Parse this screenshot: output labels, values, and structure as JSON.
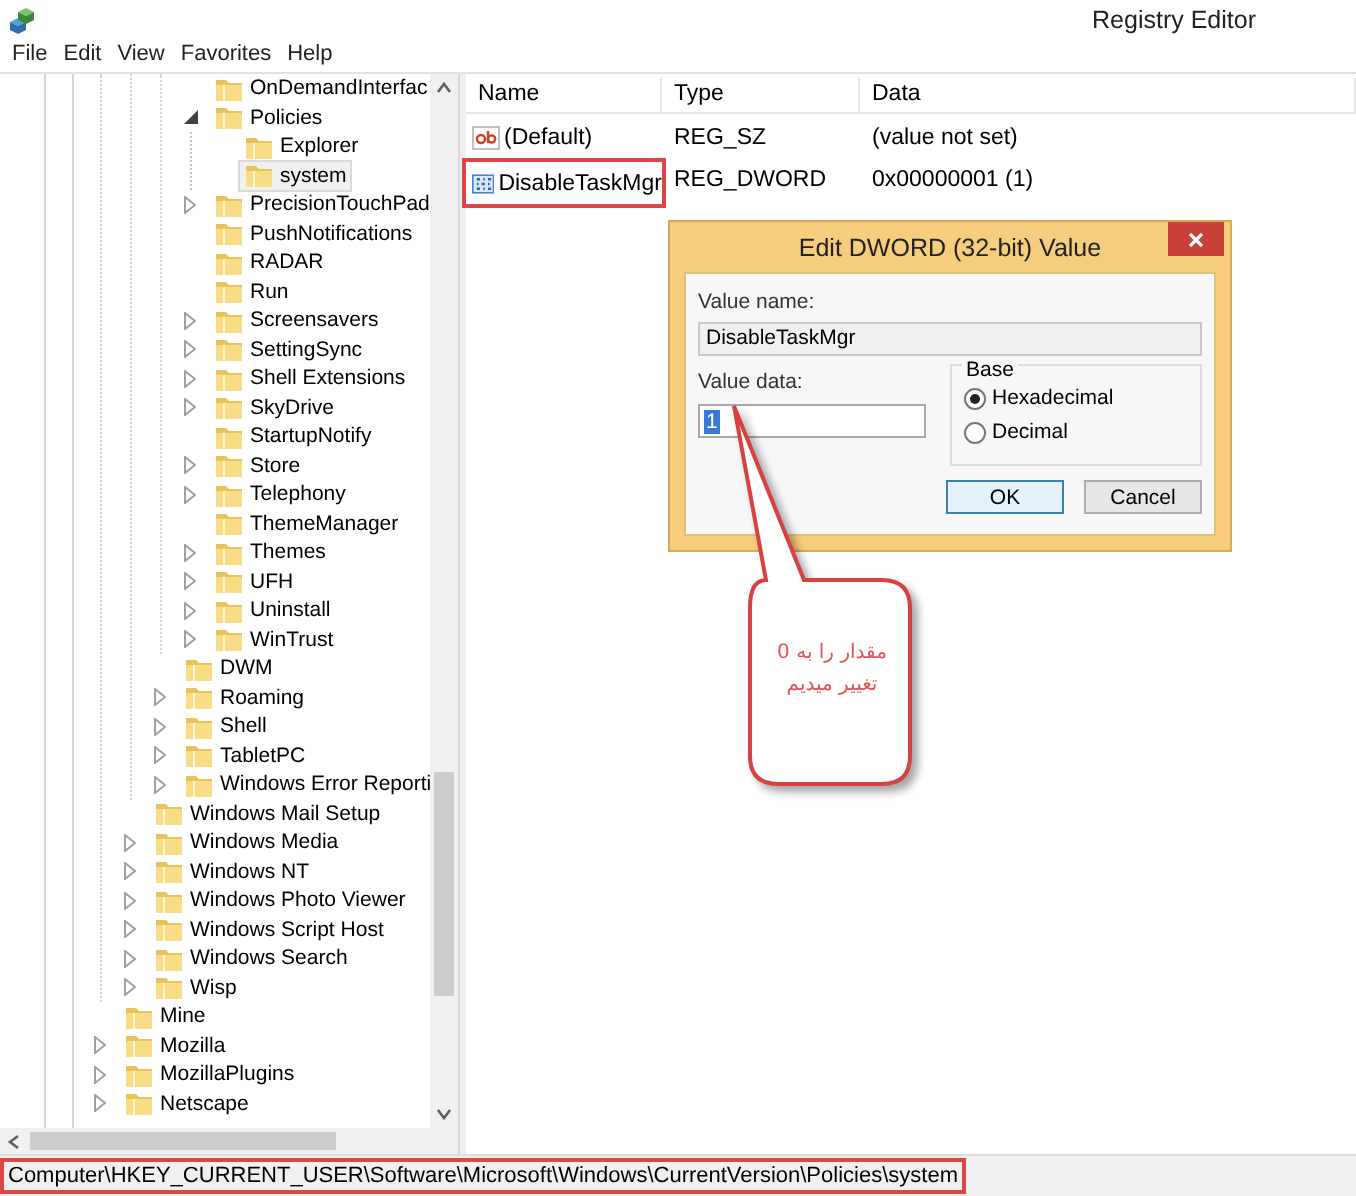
{
  "window": {
    "title": "Registry Editor"
  },
  "menu": [
    "File",
    "Edit",
    "View",
    "Favorites",
    "Help"
  ],
  "tree": {
    "items": [
      {
        "children": [
          {
            "children": [
              {
                "children": [
                  {
                    "label": "OnDemandInterfac",
                    "selected": false
                  },
                  {
                    "label": "Policies",
                    "expanded": true,
                    "selected": false,
                    "children": [
                      {
                        "label": "Explorer",
                        "selected": false
                      },
                      {
                        "label": "system",
                        "selected": true
                      }
                    ]
                  },
                  {
                    "label": "PrecisionTouchPad",
                    "expanded": false,
                    "selected": false
                  },
                  {
                    "label": "PushNotifications",
                    "selected": false
                  },
                  {
                    "label": "RADAR",
                    "selected": false
                  },
                  {
                    "label": "Run",
                    "selected": false
                  },
                  {
                    "label": "Screensavers",
                    "expanded": false,
                    "selected": false
                  },
                  {
                    "label": "SettingSync",
                    "expanded": false,
                    "selected": false
                  },
                  {
                    "label": "Shell Extensions",
                    "expanded": false,
                    "selected": false
                  },
                  {
                    "label": "SkyDrive",
                    "expanded": false,
                    "selected": false
                  },
                  {
                    "label": "StartupNotify",
                    "selected": false
                  },
                  {
                    "label": "Store",
                    "expanded": false,
                    "selected": false
                  },
                  {
                    "label": "Telephony",
                    "expanded": false,
                    "selected": false
                  },
                  {
                    "label": "ThemeManager",
                    "selected": false
                  },
                  {
                    "label": "Themes",
                    "expanded": false,
                    "selected": false
                  },
                  {
                    "label": "UFH",
                    "expanded": false,
                    "selected": false
                  },
                  {
                    "label": "Uninstall",
                    "expanded": false,
                    "selected": false
                  },
                  {
                    "label": "WinTrust",
                    "expanded": false,
                    "selected": false
                  }
                ]
              },
              {
                "label": "DWM",
                "selected": false
              },
              {
                "label": "Roaming",
                "expanded": false,
                "selected": false
              },
              {
                "label": "Shell",
                "expanded": false,
                "selected": false
              },
              {
                "label": "TabletPC",
                "expanded": false,
                "selected": false
              },
              {
                "label": "Windows Error Reporti",
                "expanded": false,
                "selected": false
              }
            ]
          },
          {
            "label": "Windows Mail Setup",
            "selected": false
          },
          {
            "label": "Windows Media",
            "expanded": false,
            "selected": false
          },
          {
            "label": "Windows NT",
            "expanded": false,
            "selected": false
          },
          {
            "label": "Windows Photo Viewer",
            "expanded": false,
            "selected": false
          },
          {
            "label": "Windows Script Host",
            "expanded": false,
            "selected": false
          },
          {
            "label": "Windows Search",
            "expanded": false,
            "selected": false
          },
          {
            "label": "Wisp",
            "expanded": false,
            "selected": false
          }
        ]
      },
      {
        "label": "Mine",
        "selected": false
      },
      {
        "label": "Mozilla",
        "expanded": false,
        "selected": false
      },
      {
        "label": "MozillaPlugins",
        "expanded": false,
        "selected": false
      },
      {
        "label": "Netscape",
        "expanded": false,
        "selected": false
      }
    ]
  },
  "values": {
    "columns": [
      "Name",
      "Type",
      "Data"
    ],
    "rows": [
      {
        "kind": "string",
        "name": "(Default)",
        "type": "REG_SZ",
        "data": "(value not set)",
        "highlighted": false
      },
      {
        "kind": "binary",
        "name": "DisableTaskMgr",
        "type": "REG_DWORD",
        "data": "0x00000001 (1)",
        "highlighted": true
      }
    ]
  },
  "dialog": {
    "title": "Edit DWORD (32-bit) Value",
    "value_name_label": "Value name:",
    "value_name": "DisableTaskMgr",
    "value_data_label": "Value data:",
    "value_data": "1",
    "value_data_selected": true,
    "base_label": "Base",
    "bases": [
      {
        "label": "Hexadecimal",
        "selected": true
      },
      {
        "label": "Decimal",
        "selected": false
      }
    ],
    "buttons": [
      "OK",
      "Cancel"
    ]
  },
  "callout": {
    "lines": [
      "مقدار را به 0",
      "تغییر میدیم"
    ]
  },
  "status_bar": {
    "path": "Computer\\HKEY_CURRENT_USER\\Software\\Microsoft\\Windows\\CurrentVersion\\Policies\\system",
    "highlighted": true
  }
}
